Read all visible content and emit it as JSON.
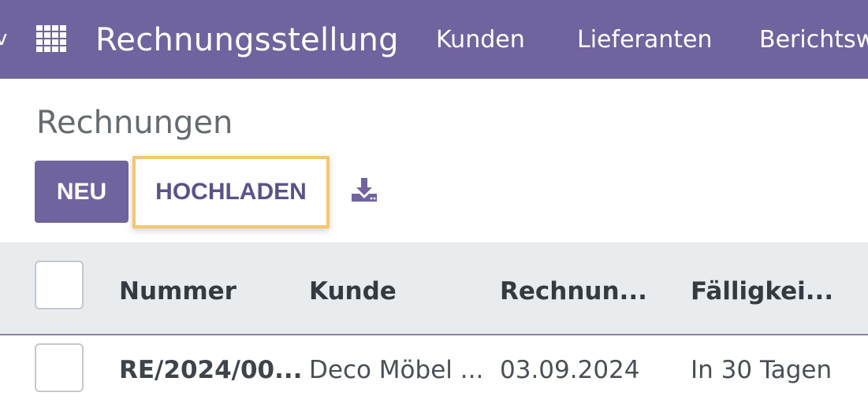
{
  "topbar": {
    "app_title": "Rechnungsstellung",
    "nav": [
      "Kunden",
      "Lieferanten",
      "Berichtsw"
    ],
    "caret_fragment": "v"
  },
  "page": {
    "title": "Rechnungen"
  },
  "toolbar": {
    "new_label": "NEU",
    "upload_label": "HOCHLADEN"
  },
  "table": {
    "headers": [
      "Nummer",
      "Kunde",
      "Rechnun...",
      "Fälligkei..."
    ],
    "rows": [
      [
        "RE/2024/00...",
        "Deco Möbel ...",
        "03.09.2024",
        "In 30 Tagen"
      ]
    ]
  },
  "icons": {
    "apps": "grid-apps-icon",
    "download": "download-icon"
  },
  "colors": {
    "brand": "#71639e",
    "highlight": "#f6c66e",
    "header_bg": "#e9ecef"
  }
}
